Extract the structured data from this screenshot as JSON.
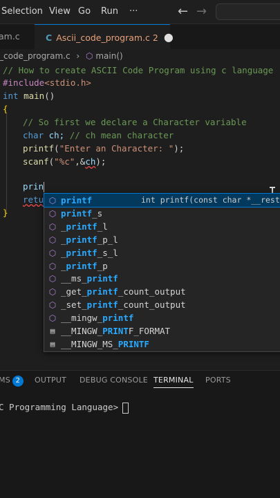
{
  "menubar": {
    "items": [
      "Selection",
      "View",
      "Go",
      "Run",
      "···"
    ],
    "back_icon": "←",
    "forward_icon": "→"
  },
  "tabs": [
    {
      "label": "am.c",
      "active": false
    },
    {
      "label": "Ascii_code_program.c",
      "active": true,
      "errors": "2",
      "icon": "C",
      "modified": "●"
    }
  ],
  "breadcrumb": {
    "file": "_code_program.c",
    "symbol": "main()"
  },
  "editor": {
    "lines": [
      "// How to create ASCII Code Program using c language",
      "#include<stdio.h>",
      "int main()",
      "{",
      "// So first we declare a Character variable",
      "char ch; // ch mean character",
      "printf(\"Enter an Character: \");",
      "scanf(\"%c\",&ch);",
      "prin",
      "retu",
      "}"
    ],
    "comment1": "// How to create ASCII Code Program using c language",
    "include_kw": "#include",
    "include_hdr": "<stdio.h>",
    "int_kw": "int",
    "main_fn": "main",
    "main_parens": "()",
    "open_brace": "{",
    "comment2": "// So first we declare a Character variable",
    "char_kw": "char",
    "char_rest": " ch; ",
    "comment3": "// ch mean character",
    "printf_fn": "printf",
    "printf_open": "(",
    "printf_str": "\"Enter an Character: \"",
    "printf_close": ");",
    "scanf_fn": "scanf",
    "scanf_open": "(",
    "scanf_str": "\"%c\"",
    "scanf_comma": ",&",
    "scanf_var": "ch",
    "scanf_close": ");",
    "typed": "prin",
    "return_partial": "retu",
    "close_brace": "}"
  },
  "suggestions": [
    {
      "pre": "",
      "match": "printf",
      "post": "",
      "kind": "method",
      "detail": "int printf(const char *__restri",
      "selected": true
    },
    {
      "pre": "",
      "match": "printf",
      "post": "_s",
      "kind": "method"
    },
    {
      "pre": "_",
      "match": "printf",
      "post": "_l",
      "kind": "method"
    },
    {
      "pre": "_",
      "match": "printf",
      "post": "_p_l",
      "kind": "method"
    },
    {
      "pre": "_",
      "match": "printf",
      "post": "_s_l",
      "kind": "method"
    },
    {
      "pre": "_",
      "match": "printf",
      "post": "_p",
      "kind": "method"
    },
    {
      "pre": "__ms_",
      "match": "printf",
      "post": "",
      "kind": "method"
    },
    {
      "pre": "_get_",
      "match": "printf",
      "post": "_count_output",
      "kind": "method"
    },
    {
      "pre": "_set_",
      "match": "printf",
      "post": "_count_output",
      "kind": "method"
    },
    {
      "pre": "__mingw_",
      "match": "printf",
      "post": "",
      "kind": "method"
    },
    {
      "pre": "__MINGW_",
      "match": "PRINT",
      "post": "F_FORMAT",
      "kind": "macro"
    },
    {
      "pre": "__MINGW_MS_",
      "match": "PRINTF",
      "post": "",
      "kind": "macro"
    }
  ],
  "panel": {
    "tabs": [
      "MS",
      "OUTPUT",
      "DEBUG CONSOLE",
      "TERMINAL",
      "PORTS"
    ],
    "problems_count": "2",
    "active_tab": "TERMINAL"
  },
  "terminal": {
    "prompt": "C Programming Language>"
  },
  "colors": {
    "accent": "#0078d4",
    "comment": "#6a9955",
    "keyword": "#569cd6",
    "string": "#ce9178",
    "function": "#dcdcaa",
    "match_highlight": "#2aaaff"
  }
}
